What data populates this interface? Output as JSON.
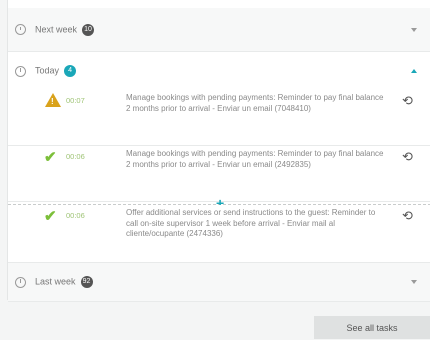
{
  "groups": {
    "next_week": {
      "label": "Next week",
      "count": "10"
    },
    "today": {
      "label": "Today",
      "count": "4"
    },
    "last_week": {
      "label": "Last week",
      "count": "92"
    }
  },
  "tasks": [
    {
      "status": "warning-icon",
      "time": "00:07",
      "description": "Manage bookings with pending payments: Reminder to pay final balance 2 months prior to arrival - Enviar un email (7048410)"
    },
    {
      "status": "check-icon",
      "time": "00:06",
      "description": "Manage bookings with pending payments: Reminder to pay final balance 2 months prior to arrival - Enviar un email (2492835)"
    },
    {
      "status": "check-icon",
      "time": "00:06",
      "description": "Offer additional services or send instructions to the guest: Reminder to call on-site supervisor 1 week before arrival - Enviar mail al cliente/ocupante (2474336)"
    }
  ],
  "see_all_label": "See all tasks",
  "colors": {
    "accent": "#1aa7b8",
    "warning": "#d9a21b",
    "success": "#7cbf3a"
  }
}
